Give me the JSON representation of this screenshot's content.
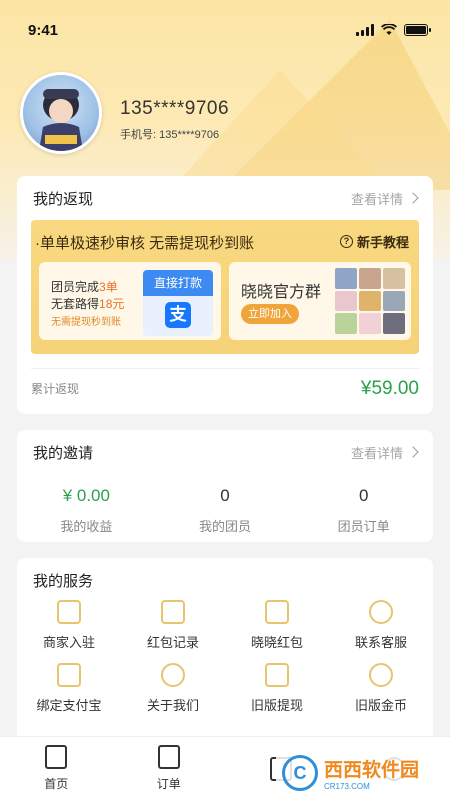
{
  "status": {
    "time": "9:41"
  },
  "profile": {
    "phone": "135****9706",
    "phone_label": "手机号: 135****9706"
  },
  "cashback": {
    "title": "我的返现",
    "more": "查看详情",
    "banner_title": "·单单极速秒审核 无需提现秒到账",
    "tutorial": "新手教程",
    "promo_line1_a": "团员完成",
    "promo_line1_b": "3单",
    "promo_line2_a": "无套路得",
    "promo_line2_b": "18元",
    "promo_line3": "无需提现秒到账",
    "direct_pay": "直接打款",
    "alipay_glyph": "支",
    "group_title": "晓晓官方群",
    "join": "立即加入",
    "total_label": "累计返现",
    "total_value": "¥59.00"
  },
  "invite": {
    "title": "我的邀请",
    "more": "查看详情",
    "stats": [
      {
        "value": "¥ 0.00",
        "label": "我的收益"
      },
      {
        "value": "0",
        "label": "我的团员"
      },
      {
        "value": "0",
        "label": "团员订单"
      }
    ]
  },
  "services": {
    "title": "我的服务",
    "items": [
      {
        "label": "商家入驻",
        "icon": "store-icon"
      },
      {
        "label": "红包记录",
        "icon": "grid-icon"
      },
      {
        "label": "晓晓红包",
        "icon": "envelope-icon"
      },
      {
        "label": "联系客服",
        "icon": "headset-icon"
      },
      {
        "label": "绑定支付宝",
        "icon": "alipay-icon"
      },
      {
        "label": "关于我们",
        "icon": "info-icon"
      },
      {
        "label": "旧版提现",
        "icon": "wallet-icon"
      },
      {
        "label": "旧版金币",
        "icon": "coins-icon"
      }
    ]
  },
  "tabbar": {
    "tabs": [
      {
        "label": "首页"
      },
      {
        "label": "订单"
      },
      {
        "label": ""
      },
      {
        "label": ""
      }
    ]
  },
  "watermark": {
    "text": "西西软件园",
    "sub": "CR173.COM"
  },
  "colors": {
    "accent": "#f6d277",
    "green": "#2ba24c",
    "orange": "#e8722a"
  }
}
